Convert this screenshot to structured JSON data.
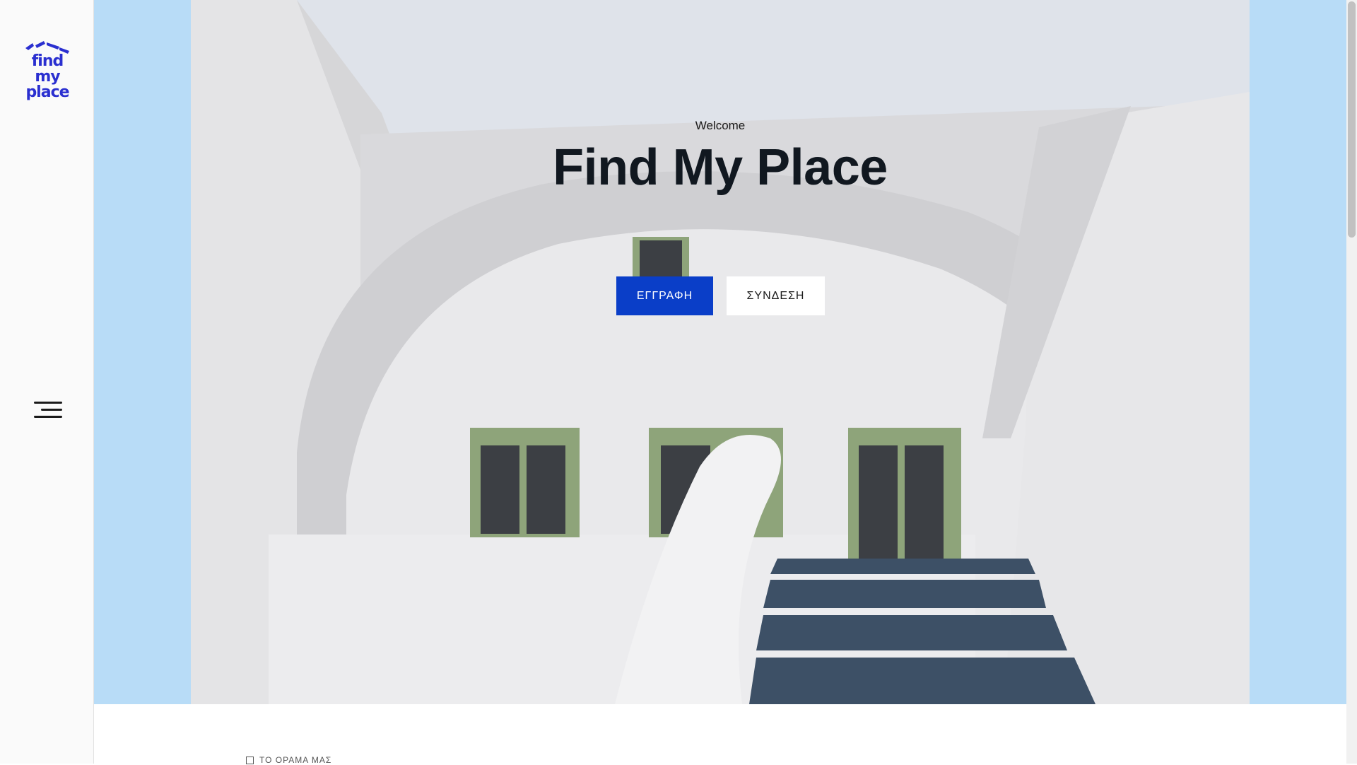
{
  "sidebar": {
    "logo_line1": "find my",
    "logo_line2": "place",
    "menu_icon": "hamburger-menu-icon"
  },
  "hero": {
    "welcome": "Welcome",
    "title": "Find My Place",
    "register_label": "ΕΓΓΡΑΦΗ",
    "login_label": "ΣΥΝΔΕΣΗ"
  },
  "section": {
    "label": "ΤΟ ΟΡΑΜΑ ΜΑΣ"
  },
  "colors": {
    "brand_blue": "#2a2fd0",
    "primary_button": "#0a3ec8",
    "hero_background": "#b8dcf7"
  }
}
